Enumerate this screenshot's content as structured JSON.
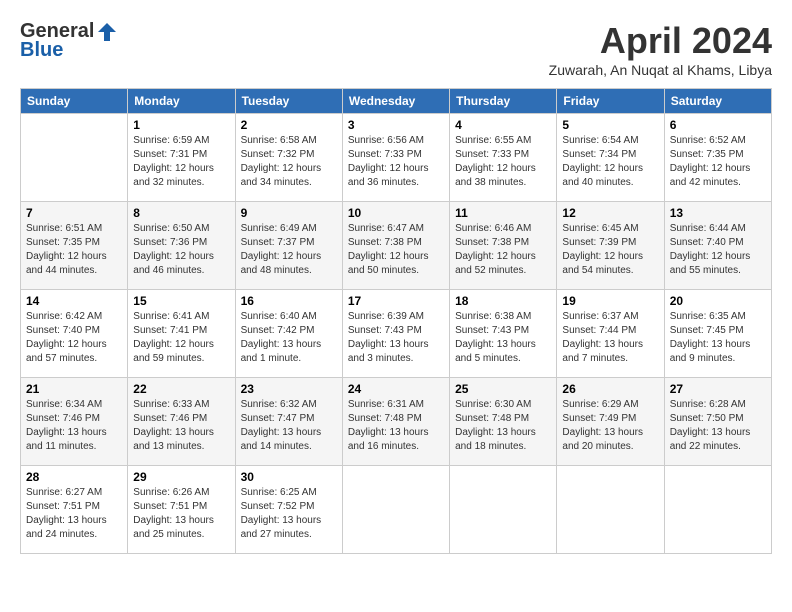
{
  "logo": {
    "general": "General",
    "blue": "Blue"
  },
  "title": "April 2024",
  "location": "Zuwarah, An Nuqat al Khams, Libya",
  "weekdays": [
    "Sunday",
    "Monday",
    "Tuesday",
    "Wednesday",
    "Thursday",
    "Friday",
    "Saturday"
  ],
  "weeks": [
    [
      {
        "day": "",
        "sunrise": "",
        "sunset": "",
        "daylight": ""
      },
      {
        "day": "1",
        "sunrise": "Sunrise: 6:59 AM",
        "sunset": "Sunset: 7:31 PM",
        "daylight": "Daylight: 12 hours and 32 minutes."
      },
      {
        "day": "2",
        "sunrise": "Sunrise: 6:58 AM",
        "sunset": "Sunset: 7:32 PM",
        "daylight": "Daylight: 12 hours and 34 minutes."
      },
      {
        "day": "3",
        "sunrise": "Sunrise: 6:56 AM",
        "sunset": "Sunset: 7:33 PM",
        "daylight": "Daylight: 12 hours and 36 minutes."
      },
      {
        "day": "4",
        "sunrise": "Sunrise: 6:55 AM",
        "sunset": "Sunset: 7:33 PM",
        "daylight": "Daylight: 12 hours and 38 minutes."
      },
      {
        "day": "5",
        "sunrise": "Sunrise: 6:54 AM",
        "sunset": "Sunset: 7:34 PM",
        "daylight": "Daylight: 12 hours and 40 minutes."
      },
      {
        "day": "6",
        "sunrise": "Sunrise: 6:52 AM",
        "sunset": "Sunset: 7:35 PM",
        "daylight": "Daylight: 12 hours and 42 minutes."
      }
    ],
    [
      {
        "day": "7",
        "sunrise": "Sunrise: 6:51 AM",
        "sunset": "Sunset: 7:35 PM",
        "daylight": "Daylight: 12 hours and 44 minutes."
      },
      {
        "day": "8",
        "sunrise": "Sunrise: 6:50 AM",
        "sunset": "Sunset: 7:36 PM",
        "daylight": "Daylight: 12 hours and 46 minutes."
      },
      {
        "day": "9",
        "sunrise": "Sunrise: 6:49 AM",
        "sunset": "Sunset: 7:37 PM",
        "daylight": "Daylight: 12 hours and 48 minutes."
      },
      {
        "day": "10",
        "sunrise": "Sunrise: 6:47 AM",
        "sunset": "Sunset: 7:38 PM",
        "daylight": "Daylight: 12 hours and 50 minutes."
      },
      {
        "day": "11",
        "sunrise": "Sunrise: 6:46 AM",
        "sunset": "Sunset: 7:38 PM",
        "daylight": "Daylight: 12 hours and 52 minutes."
      },
      {
        "day": "12",
        "sunrise": "Sunrise: 6:45 AM",
        "sunset": "Sunset: 7:39 PM",
        "daylight": "Daylight: 12 hours and 54 minutes."
      },
      {
        "day": "13",
        "sunrise": "Sunrise: 6:44 AM",
        "sunset": "Sunset: 7:40 PM",
        "daylight": "Daylight: 12 hours and 55 minutes."
      }
    ],
    [
      {
        "day": "14",
        "sunrise": "Sunrise: 6:42 AM",
        "sunset": "Sunset: 7:40 PM",
        "daylight": "Daylight: 12 hours and 57 minutes."
      },
      {
        "day": "15",
        "sunrise": "Sunrise: 6:41 AM",
        "sunset": "Sunset: 7:41 PM",
        "daylight": "Daylight: 12 hours and 59 minutes."
      },
      {
        "day": "16",
        "sunrise": "Sunrise: 6:40 AM",
        "sunset": "Sunset: 7:42 PM",
        "daylight": "Daylight: 13 hours and 1 minute."
      },
      {
        "day": "17",
        "sunrise": "Sunrise: 6:39 AM",
        "sunset": "Sunset: 7:43 PM",
        "daylight": "Daylight: 13 hours and 3 minutes."
      },
      {
        "day": "18",
        "sunrise": "Sunrise: 6:38 AM",
        "sunset": "Sunset: 7:43 PM",
        "daylight": "Daylight: 13 hours and 5 minutes."
      },
      {
        "day": "19",
        "sunrise": "Sunrise: 6:37 AM",
        "sunset": "Sunset: 7:44 PM",
        "daylight": "Daylight: 13 hours and 7 minutes."
      },
      {
        "day": "20",
        "sunrise": "Sunrise: 6:35 AM",
        "sunset": "Sunset: 7:45 PM",
        "daylight": "Daylight: 13 hours and 9 minutes."
      }
    ],
    [
      {
        "day": "21",
        "sunrise": "Sunrise: 6:34 AM",
        "sunset": "Sunset: 7:46 PM",
        "daylight": "Daylight: 13 hours and 11 minutes."
      },
      {
        "day": "22",
        "sunrise": "Sunrise: 6:33 AM",
        "sunset": "Sunset: 7:46 PM",
        "daylight": "Daylight: 13 hours and 13 minutes."
      },
      {
        "day": "23",
        "sunrise": "Sunrise: 6:32 AM",
        "sunset": "Sunset: 7:47 PM",
        "daylight": "Daylight: 13 hours and 14 minutes."
      },
      {
        "day": "24",
        "sunrise": "Sunrise: 6:31 AM",
        "sunset": "Sunset: 7:48 PM",
        "daylight": "Daylight: 13 hours and 16 minutes."
      },
      {
        "day": "25",
        "sunrise": "Sunrise: 6:30 AM",
        "sunset": "Sunset: 7:48 PM",
        "daylight": "Daylight: 13 hours and 18 minutes."
      },
      {
        "day": "26",
        "sunrise": "Sunrise: 6:29 AM",
        "sunset": "Sunset: 7:49 PM",
        "daylight": "Daylight: 13 hours and 20 minutes."
      },
      {
        "day": "27",
        "sunrise": "Sunrise: 6:28 AM",
        "sunset": "Sunset: 7:50 PM",
        "daylight": "Daylight: 13 hours and 22 minutes."
      }
    ],
    [
      {
        "day": "28",
        "sunrise": "Sunrise: 6:27 AM",
        "sunset": "Sunset: 7:51 PM",
        "daylight": "Daylight: 13 hours and 24 minutes."
      },
      {
        "day": "29",
        "sunrise": "Sunrise: 6:26 AM",
        "sunset": "Sunset: 7:51 PM",
        "daylight": "Daylight: 13 hours and 25 minutes."
      },
      {
        "day": "30",
        "sunrise": "Sunrise: 6:25 AM",
        "sunset": "Sunset: 7:52 PM",
        "daylight": "Daylight: 13 hours and 27 minutes."
      },
      {
        "day": "",
        "sunrise": "",
        "sunset": "",
        "daylight": ""
      },
      {
        "day": "",
        "sunrise": "",
        "sunset": "",
        "daylight": ""
      },
      {
        "day": "",
        "sunrise": "",
        "sunset": "",
        "daylight": ""
      },
      {
        "day": "",
        "sunrise": "",
        "sunset": "",
        "daylight": ""
      }
    ]
  ]
}
